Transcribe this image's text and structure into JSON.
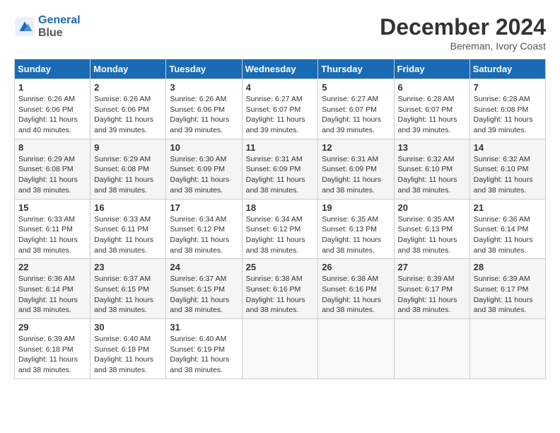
{
  "header": {
    "logo_line1": "General",
    "logo_line2": "Blue",
    "month": "December 2024",
    "location": "Bereman, Ivory Coast"
  },
  "days_of_week": [
    "Sunday",
    "Monday",
    "Tuesday",
    "Wednesday",
    "Thursday",
    "Friday",
    "Saturday"
  ],
  "weeks": [
    [
      {
        "day": "1",
        "info": "Sunrise: 6:26 AM\nSunset: 6:06 PM\nDaylight: 11 hours\nand 40 minutes."
      },
      {
        "day": "2",
        "info": "Sunrise: 6:26 AM\nSunset: 6:06 PM\nDaylight: 11 hours\nand 39 minutes."
      },
      {
        "day": "3",
        "info": "Sunrise: 6:26 AM\nSunset: 6:06 PM\nDaylight: 11 hours\nand 39 minutes."
      },
      {
        "day": "4",
        "info": "Sunrise: 6:27 AM\nSunset: 6:07 PM\nDaylight: 11 hours\nand 39 minutes."
      },
      {
        "day": "5",
        "info": "Sunrise: 6:27 AM\nSunset: 6:07 PM\nDaylight: 11 hours\nand 39 minutes."
      },
      {
        "day": "6",
        "info": "Sunrise: 6:28 AM\nSunset: 6:07 PM\nDaylight: 11 hours\nand 39 minutes."
      },
      {
        "day": "7",
        "info": "Sunrise: 6:28 AM\nSunset: 6:08 PM\nDaylight: 11 hours\nand 39 minutes."
      }
    ],
    [
      {
        "day": "8",
        "info": "Sunrise: 6:29 AM\nSunset: 6:08 PM\nDaylight: 11 hours\nand 38 minutes."
      },
      {
        "day": "9",
        "info": "Sunrise: 6:29 AM\nSunset: 6:08 PM\nDaylight: 11 hours\nand 38 minutes."
      },
      {
        "day": "10",
        "info": "Sunrise: 6:30 AM\nSunset: 6:09 PM\nDaylight: 11 hours\nand 38 minutes."
      },
      {
        "day": "11",
        "info": "Sunrise: 6:31 AM\nSunset: 6:09 PM\nDaylight: 11 hours\nand 38 minutes."
      },
      {
        "day": "12",
        "info": "Sunrise: 6:31 AM\nSunset: 6:09 PM\nDaylight: 11 hours\nand 38 minutes."
      },
      {
        "day": "13",
        "info": "Sunrise: 6:32 AM\nSunset: 6:10 PM\nDaylight: 11 hours\nand 38 minutes."
      },
      {
        "day": "14",
        "info": "Sunrise: 6:32 AM\nSunset: 6:10 PM\nDaylight: 11 hours\nand 38 minutes."
      }
    ],
    [
      {
        "day": "15",
        "info": "Sunrise: 6:33 AM\nSunset: 6:11 PM\nDaylight: 11 hours\nand 38 minutes."
      },
      {
        "day": "16",
        "info": "Sunrise: 6:33 AM\nSunset: 6:11 PM\nDaylight: 11 hours\nand 38 minutes."
      },
      {
        "day": "17",
        "info": "Sunrise: 6:34 AM\nSunset: 6:12 PM\nDaylight: 11 hours\nand 38 minutes."
      },
      {
        "day": "18",
        "info": "Sunrise: 6:34 AM\nSunset: 6:12 PM\nDaylight: 11 hours\nand 38 minutes."
      },
      {
        "day": "19",
        "info": "Sunrise: 6:35 AM\nSunset: 6:13 PM\nDaylight: 11 hours\nand 38 minutes."
      },
      {
        "day": "20",
        "info": "Sunrise: 6:35 AM\nSunset: 6:13 PM\nDaylight: 11 hours\nand 38 minutes."
      },
      {
        "day": "21",
        "info": "Sunrise: 6:36 AM\nSunset: 6:14 PM\nDaylight: 11 hours\nand 38 minutes."
      }
    ],
    [
      {
        "day": "22",
        "info": "Sunrise: 6:36 AM\nSunset: 6:14 PM\nDaylight: 11 hours\nand 38 minutes."
      },
      {
        "day": "23",
        "info": "Sunrise: 6:37 AM\nSunset: 6:15 PM\nDaylight: 11 hours\nand 38 minutes."
      },
      {
        "day": "24",
        "info": "Sunrise: 6:37 AM\nSunset: 6:15 PM\nDaylight: 11 hours\nand 38 minutes."
      },
      {
        "day": "25",
        "info": "Sunrise: 6:38 AM\nSunset: 6:16 PM\nDaylight: 11 hours\nand 38 minutes."
      },
      {
        "day": "26",
        "info": "Sunrise: 6:38 AM\nSunset: 6:16 PM\nDaylight: 11 hours\nand 38 minutes."
      },
      {
        "day": "27",
        "info": "Sunrise: 6:39 AM\nSunset: 6:17 PM\nDaylight: 11 hours\nand 38 minutes."
      },
      {
        "day": "28",
        "info": "Sunrise: 6:39 AM\nSunset: 6:17 PM\nDaylight: 11 hours\nand 38 minutes."
      }
    ],
    [
      {
        "day": "29",
        "info": "Sunrise: 6:39 AM\nSunset: 6:18 PM\nDaylight: 11 hours\nand 38 minutes."
      },
      {
        "day": "30",
        "info": "Sunrise: 6:40 AM\nSunset: 6:18 PM\nDaylight: 11 hours\nand 38 minutes."
      },
      {
        "day": "31",
        "info": "Sunrise: 6:40 AM\nSunset: 6:19 PM\nDaylight: 11 hours\nand 38 minutes."
      },
      {
        "day": "",
        "info": ""
      },
      {
        "day": "",
        "info": ""
      },
      {
        "day": "",
        "info": ""
      },
      {
        "day": "",
        "info": ""
      }
    ]
  ]
}
